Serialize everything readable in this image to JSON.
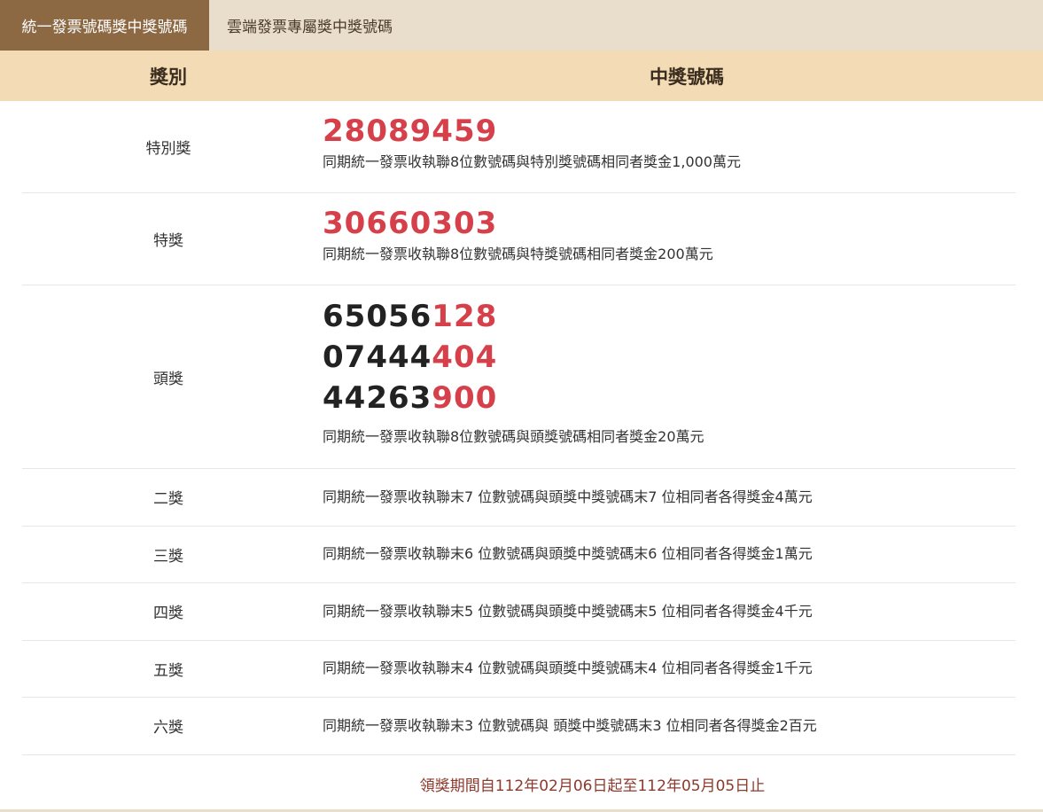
{
  "tabs": [
    {
      "label": "統一發票號碼獎中獎號碼",
      "active": true
    },
    {
      "label": "雲端發票專屬獎中獎號碼",
      "active": false
    }
  ],
  "table": {
    "header": {
      "prize": "獎別",
      "numbers": "中獎號碼"
    },
    "special": {
      "name": "特別獎",
      "number": "28089459",
      "desc": "同期統一發票收執聯8位數號碼與特別獎號碼相同者獎金1,000萬元"
    },
    "grand": {
      "name": "特獎",
      "number": "30660303",
      "desc": "同期統一發票收執聯8位數號碼與特獎號碼相同者獎金200萬元"
    },
    "first": {
      "name": "頭獎",
      "numbers": [
        {
          "head": "65056",
          "tail": "128"
        },
        {
          "head": "07444",
          "tail": "404"
        },
        {
          "head": "44263",
          "tail": "900"
        }
      ],
      "desc": "同期統一發票收執聯8位數號碼與頭獎號碼相同者獎金20萬元"
    },
    "others": [
      {
        "name": "二獎",
        "desc": "同期統一發票收執聯末7 位數號碼與頭獎中獎號碼末7 位相同者各得獎金4萬元"
      },
      {
        "name": "三獎",
        "desc": "同期統一發票收執聯末6 位數號碼與頭獎中獎號碼末6 位相同者各得獎金1萬元"
      },
      {
        "name": "四獎",
        "desc": "同期統一發票收執聯末5 位數號碼與頭獎中獎號碼末5 位相同者各得獎金4千元"
      },
      {
        "name": "五獎",
        "desc": "同期統一發票收執聯末4 位數號碼與頭獎中獎號碼末4 位相同者各得獎金1千元"
      },
      {
        "name": "六獎",
        "desc": "同期統一發票收執聯末3 位數號碼與 頭獎中獎號碼末3 位相同者各得獎金2百元"
      }
    ]
  },
  "footer": {
    "claim_period": "領獎期間自112年02月06日起至112年05月05日止"
  },
  "colors": {
    "accent_red": "#d6404a",
    "tab_active": "#8c6843",
    "header_bg": "#f3dcb5"
  }
}
